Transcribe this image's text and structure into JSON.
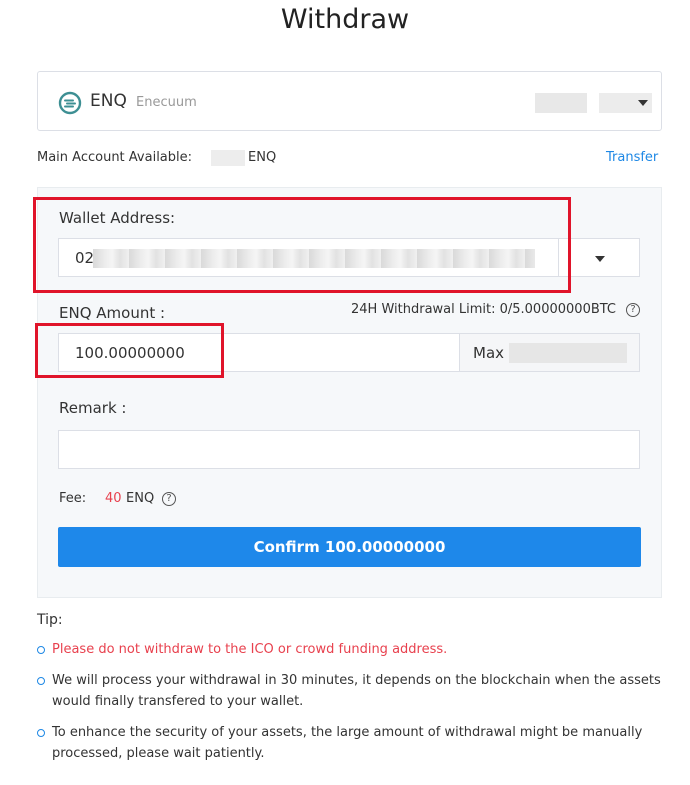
{
  "page": {
    "title": "Withdraw"
  },
  "coin": {
    "symbol": "ENQ",
    "name": "Enecuum",
    "icon": "enecuum-logo-icon"
  },
  "account": {
    "available_label": "Main Account Available:",
    "unit": "ENQ",
    "transfer_label": "Transfer"
  },
  "form": {
    "wallet_label": "Wallet Address:",
    "wallet_value_prefix": "02",
    "amount_label": "ENQ Amount :",
    "limit_text": "24H Withdrawal Limit: 0/5.00000000BTC",
    "amount_value": "100.00000000",
    "max_label": "Max",
    "remark_label": "Remark :",
    "remark_value": "",
    "fee_label": "Fee:",
    "fee_value": "40",
    "fee_unit": "ENQ",
    "confirm_label": "Confirm 100.00000000"
  },
  "tips": {
    "title": "Tip:",
    "items": [
      "Please do not withdraw to the ICO or crowd funding address.",
      "We will process your withdrawal in 30 minutes, it depends on the blockchain when the assets would finally transfered to your wallet.",
      "To enhance the security of your assets, the large amount of withdrawal might be manually processed, please wait patiently."
    ]
  },
  "colors": {
    "accent": "#1e88ea",
    "danger": "#e8414e",
    "highlight": "#e0142a",
    "panel": "#f6f8fa"
  }
}
